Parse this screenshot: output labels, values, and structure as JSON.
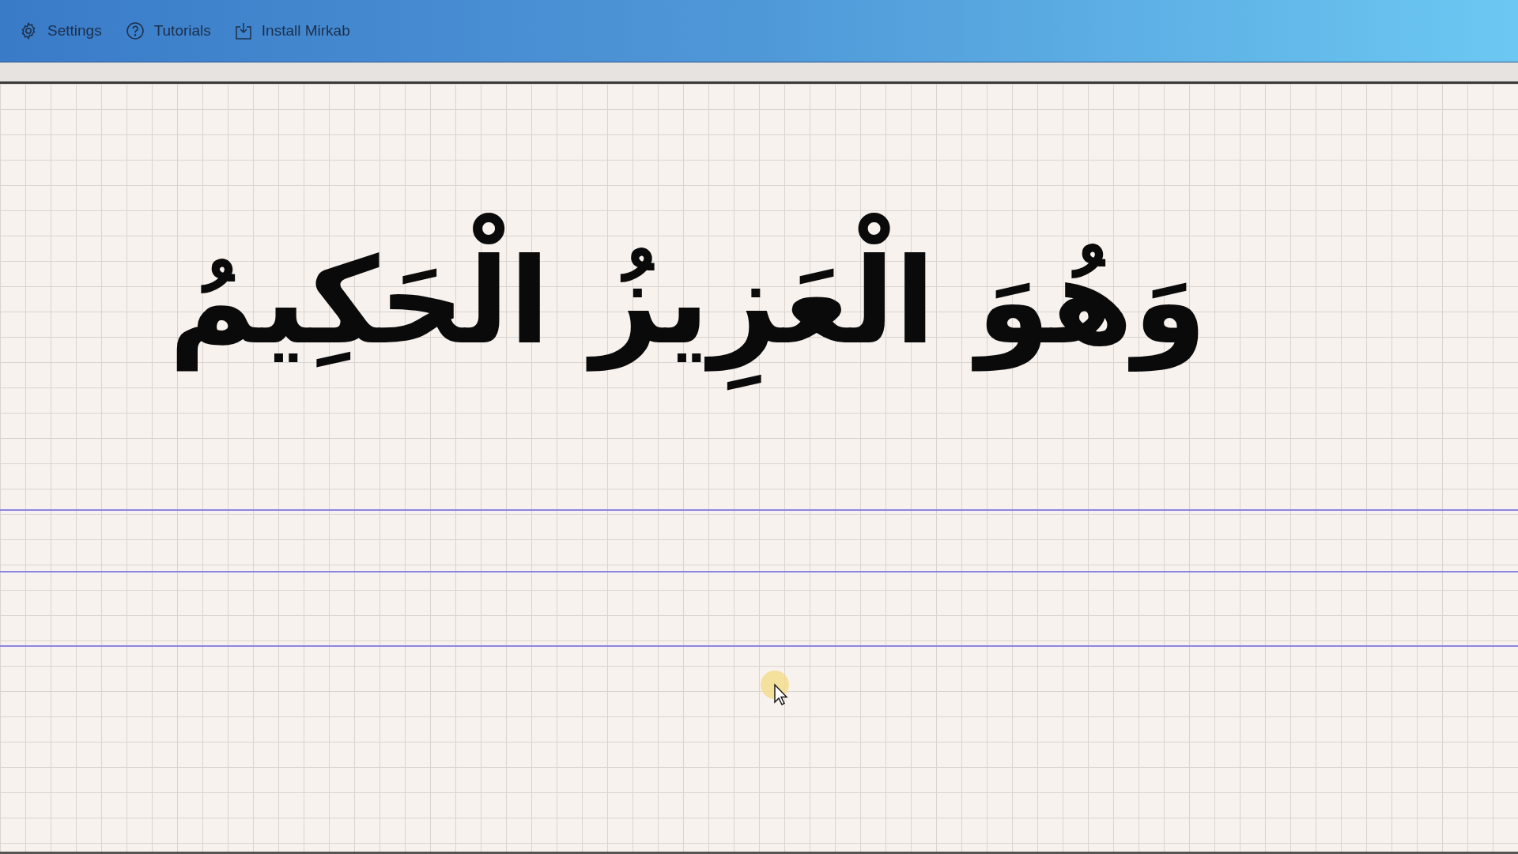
{
  "toolbar": {
    "buttons": [
      {
        "kind": "settings",
        "label": "Settings"
      },
      {
        "kind": "help",
        "label": "Tutorials"
      },
      {
        "kind": "install",
        "label": "Install Mirkab"
      }
    ]
  },
  "canvas": {
    "calligraphy": "وَهُوَ الْعَزِيزُ الْحَكِيمُ"
  }
}
